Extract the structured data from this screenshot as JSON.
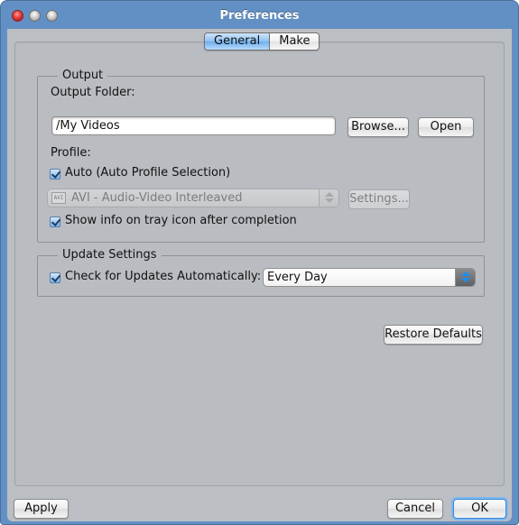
{
  "window": {
    "title": "Preferences",
    "controls": [
      "close",
      "minimize",
      "zoom"
    ]
  },
  "tabs": [
    {
      "label": "General",
      "active": true
    },
    {
      "label": "Make",
      "active": false
    }
  ],
  "output": {
    "legend": "Output",
    "folder_label": "Output Folder:",
    "folder_value": "/My Videos",
    "browse_label": "Browse...",
    "open_label": "Open",
    "profile_label": "Profile:",
    "auto_checkbox": {
      "label": "Auto (Auto Profile Selection)",
      "checked": true
    },
    "profile_select": {
      "value": "AVI - Audio-Video Interleaved",
      "icon": "avi-file-icon",
      "icon_text": "AVI",
      "enabled": false
    },
    "settings_label": "Settings...",
    "tray_checkbox": {
      "label": "Show info on tray icon after completion",
      "checked": true
    }
  },
  "update": {
    "legend": "Update Settings",
    "check_checkbox": {
      "label": "Check for Updates Automatically:",
      "checked": true
    },
    "frequency_select": {
      "value": "Every Day",
      "enabled": true
    }
  },
  "restore_defaults_label": "Restore Defaults",
  "footer": {
    "apply_label": "Apply",
    "cancel_label": "Cancel",
    "ok_label": "OK"
  }
}
